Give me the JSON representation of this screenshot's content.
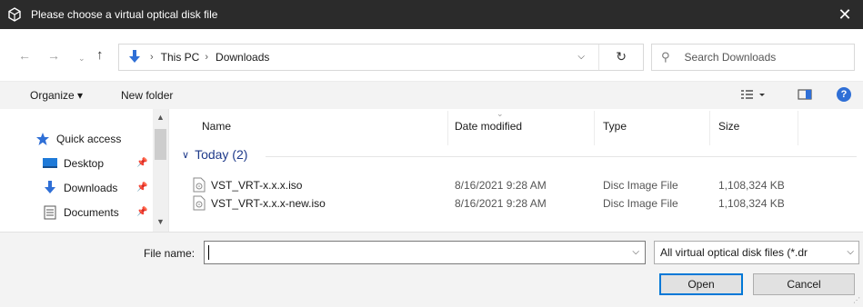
{
  "window": {
    "title": "Please choose a virtual optical disk file",
    "close_glyph": "✕",
    "app_icon": "virtualbox-icon"
  },
  "address": {
    "crumbs": [
      "This PC",
      "Downloads"
    ],
    "separator": "›",
    "search_placeholder": "Search Downloads"
  },
  "toolbar": {
    "organize_label": "Organize ▾",
    "new_folder_label": "New folder",
    "help_label": "?"
  },
  "nav": {
    "items": [
      {
        "label": "Quick access",
        "icon": "star-icon"
      },
      {
        "label": "Desktop",
        "icon": "desktop-icon"
      },
      {
        "label": "Downloads",
        "icon": "download-arrow-icon"
      },
      {
        "label": "Documents",
        "icon": "document-icon"
      }
    ]
  },
  "columns": {
    "name": "Name",
    "date": "Date modified",
    "type": "Type",
    "size": "Size"
  },
  "group": {
    "label": "Today (2)"
  },
  "files": [
    {
      "name": "VST_VRT-x.x.x.iso",
      "date": "8/16/2021 9:28 AM",
      "type": "Disc Image File",
      "size": "1,108,324 KB"
    },
    {
      "name": "VST_VRT-x.x.x-new.iso",
      "date": "8/16/2021 9:28 AM",
      "type": "Disc Image File",
      "size": "1,108,324 KB"
    }
  ],
  "bottom": {
    "file_name_label": "File name:",
    "file_name_value": "",
    "filter_value": "All virtual optical disk files (*.dr",
    "open_label": "Open",
    "cancel_label": "Cancel"
  },
  "colors": {
    "titlebar": "#2b2b2b",
    "accent": "#0078d7",
    "group_text": "#1e3a8a"
  }
}
